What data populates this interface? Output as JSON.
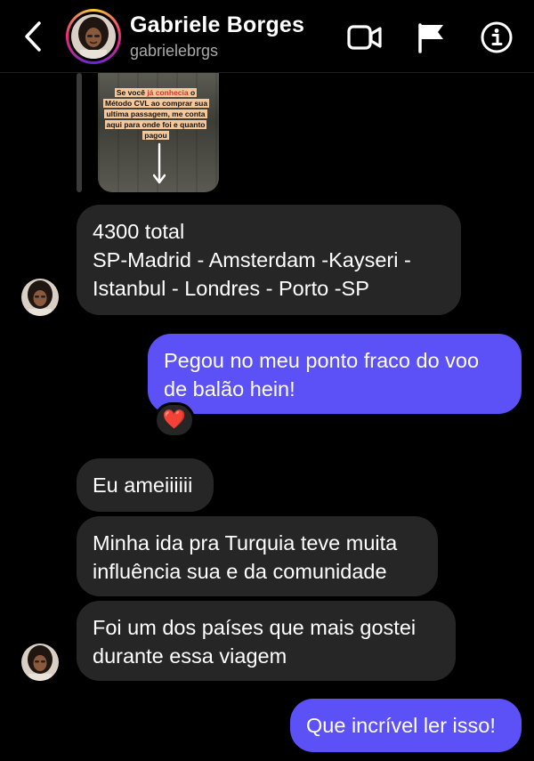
{
  "header": {
    "name": "Gabriele Borges",
    "username": "gabrielebrgs",
    "icons": [
      "back-arrow-icon",
      "video-call-icon",
      "flag-icon",
      "info-icon"
    ]
  },
  "story": {
    "caption_part1": "Se você ",
    "caption_highlight": "já conhecia",
    "caption_part2": " o Método CVL ao comprar sua ultima passagem, me conta aqui para onde foi e quanto pagou"
  },
  "messages": [
    {
      "from": "them",
      "lines": [
        "4300 total",
        "SP-Madrid - Amsterdam -Kayseri -",
        "Istanbul - Londres - Porto -SP"
      ]
    },
    {
      "from": "me",
      "lines": [
        "Pegou no meu ponto fraco do voo",
        "de balão hein!"
      ],
      "reaction": "❤️"
    },
    {
      "from": "them",
      "lines": [
        "Eu ameiiiiii"
      ]
    },
    {
      "from": "them",
      "lines": [
        "Minha ida pra Turquia teve muita",
        "influência sua e da comunidade"
      ]
    },
    {
      "from": "them",
      "lines": [
        "Foi um dos países que mais gostei",
        "durante essa viagem"
      ]
    },
    {
      "from": "me",
      "lines": [
        "Que incrível ler isso!"
      ]
    }
  ],
  "colors": {
    "background": "#000000",
    "incoming_bubble": "#262626",
    "outgoing_bubble": "#5b51f6",
    "secondary_text": "#a8a8a8"
  }
}
